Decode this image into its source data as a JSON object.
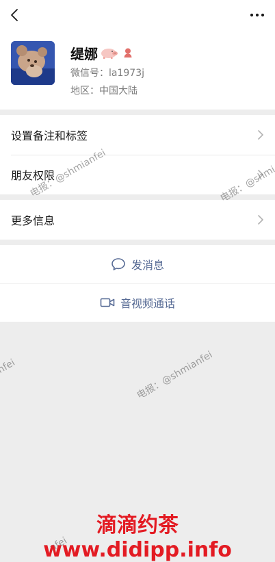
{
  "profile": {
    "name": "缇娜",
    "wechat_id_line": "微信号：la1973j",
    "region_line": "地区：中国大陆"
  },
  "menu": {
    "group1": [
      {
        "label": "设置备注和标签"
      },
      {
        "label": "朋友权限"
      }
    ],
    "group2": [
      {
        "label": "更多信息"
      }
    ]
  },
  "actions": {
    "message": "发消息",
    "video_call": "音视频通话"
  },
  "watermarks": {
    "w1": "电报：@shmianfei",
    "w2": "电报：@shmi",
    "w3": "nfei",
    "w4": "电报：@shmianfei",
    "w5": "nfei"
  },
  "banner": "滴滴约茶 www.didipp.info",
  "icons": {
    "back": "chevron-left-icon",
    "more": "more-dots-icon",
    "gender": "female-icon",
    "emoji": "pig-emoji-icon",
    "message": "chat-bubble-icon",
    "video": "video-camera-icon"
  },
  "colors": {
    "link": "#576b95",
    "banner": "#e31b23",
    "gender": "#e2706b"
  }
}
